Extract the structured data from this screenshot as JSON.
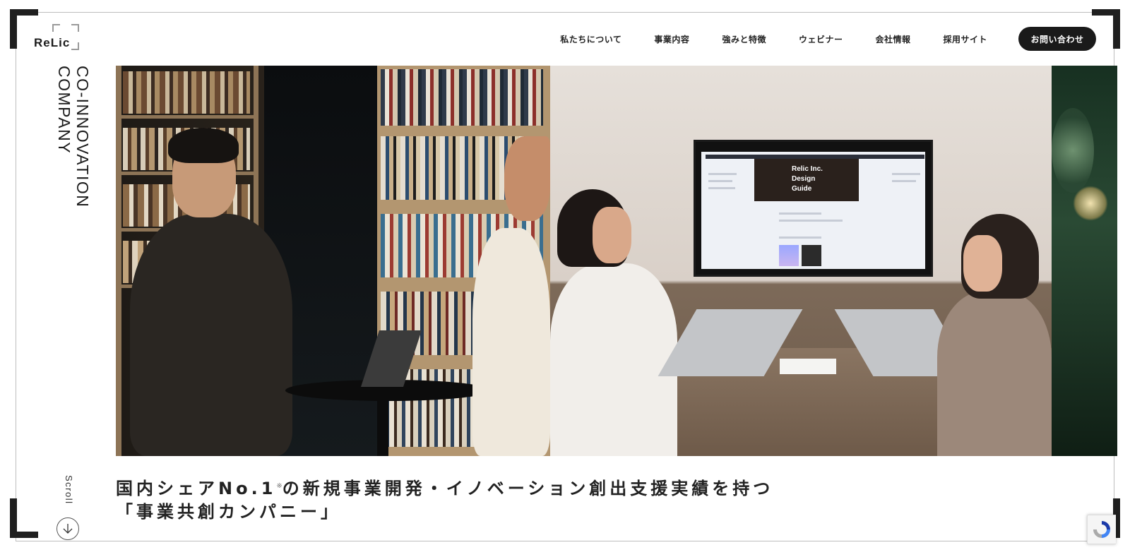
{
  "logo": {
    "text": "ReLic",
    "icon": "relic-logo"
  },
  "nav": {
    "items": [
      {
        "label": "私たちについて"
      },
      {
        "label": "事業内容"
      },
      {
        "label": "強みと特徴"
      },
      {
        "label": "ウェビナー"
      },
      {
        "label": "会社情報"
      },
      {
        "label": "採用サイト"
      }
    ],
    "contact_label": "お問い合わせ"
  },
  "tagline": {
    "line1": "CO-INNOVATION",
    "line2": "COMPANY"
  },
  "hero": {
    "screen_title_1": "Relic Inc.",
    "screen_title_2": "Design",
    "screen_title_3": "Guide"
  },
  "headline": {
    "line1_main": "国内シェアNo.1",
    "line1_mark": "※",
    "line1_rest": "の新規事業開発・イノベーション創出支援実績を持つ",
    "line2": "「事業共創カンパニー」"
  },
  "scroll": {
    "label": "Scroll",
    "icon": "arrow-down-icon"
  },
  "recaptcha": {
    "icon": "recaptcha-icon"
  },
  "colors": {
    "accent": "#1a1a1a",
    "background": "#ffffff",
    "frame": "#1f1f1f"
  }
}
